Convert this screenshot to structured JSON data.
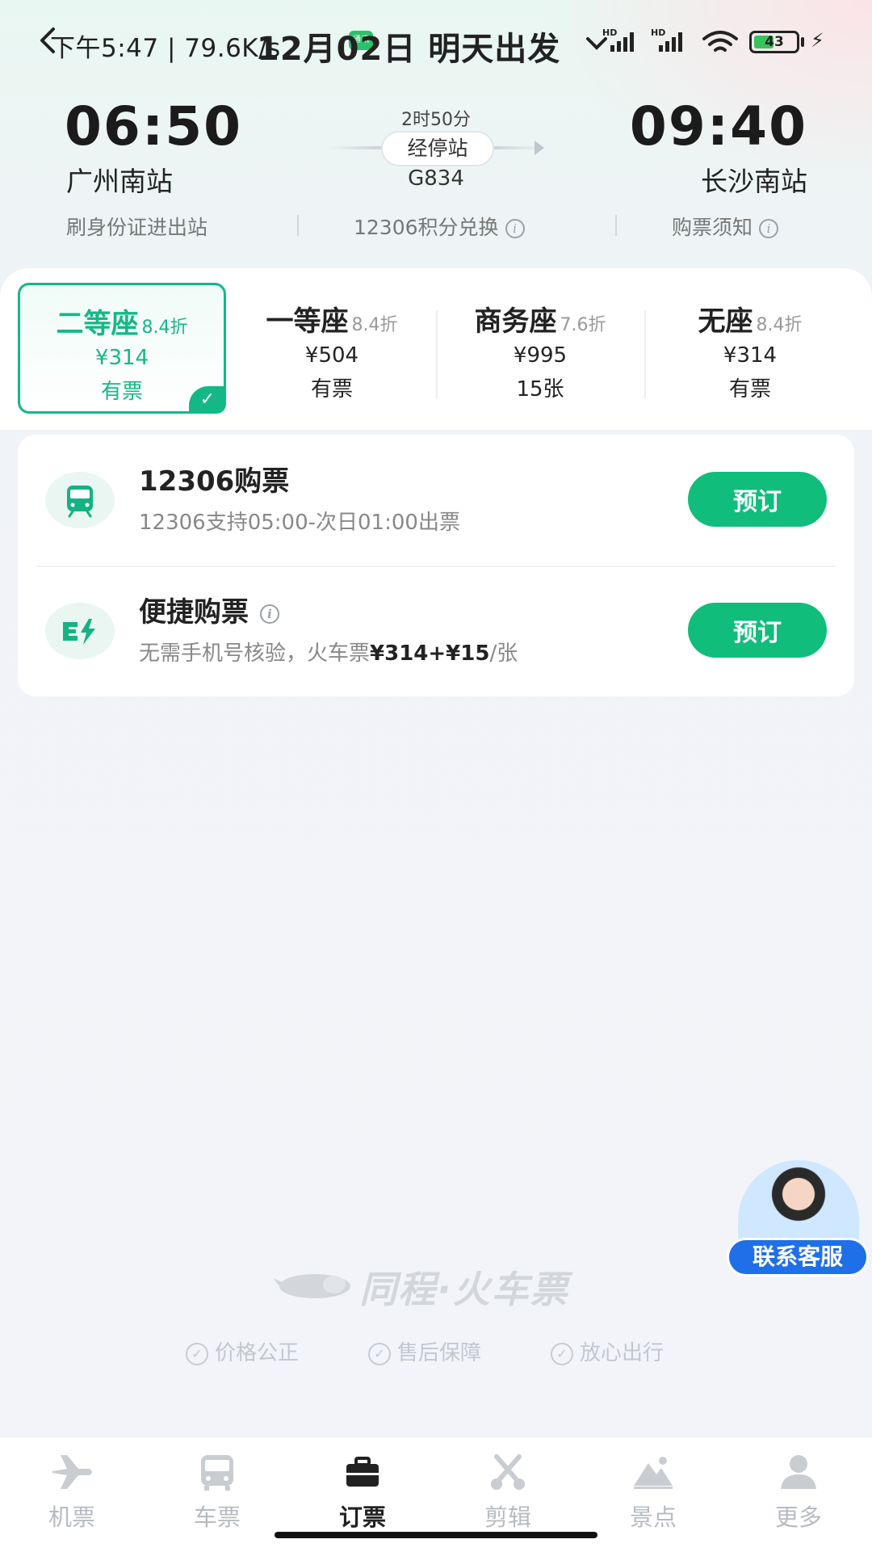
{
  "status_bar": {
    "time": "下午5:47 | 79.6K/s",
    "app_badge": "通讯",
    "battery": "43"
  },
  "header": {
    "date_title": "12月02日 明天出发"
  },
  "train": {
    "departure_time": "06:50",
    "departure_station": "广州南站",
    "arrival_time": "09:40",
    "arrival_station": "长沙南站",
    "duration": "2时50分",
    "stops_label": "经停站",
    "train_number": "G834"
  },
  "links": {
    "id_card": "刷身份证进出站",
    "points": "12306积分兑换",
    "notice": "购票须知"
  },
  "seats": [
    {
      "name": "二等座",
      "discount": "8.4折",
      "price": "¥314",
      "availability": "有票",
      "selected": true
    },
    {
      "name": "一等座",
      "discount": "8.4折",
      "price": "¥504",
      "availability": "有票",
      "selected": false
    },
    {
      "name": "商务座",
      "discount": "7.6折",
      "price": "¥995",
      "availability": "15张",
      "selected": false
    },
    {
      "name": "无座",
      "discount": "8.4折",
      "price": "¥314",
      "availability": "有票",
      "selected": false
    }
  ],
  "options": [
    {
      "title": "12306购票",
      "desc": "12306支持05:00-次日01:00出票",
      "button": "预订",
      "icon": "train-icon"
    },
    {
      "title": "便捷购票",
      "desc_prefix": "无需手机号核验，火车票",
      "desc_price": "¥314+¥15",
      "desc_suffix": "/张",
      "button": "预订",
      "icon": "fast-ticket-icon"
    }
  ],
  "brand": {
    "name": "同程·火车票",
    "promises": [
      "价格公正",
      "售后保障",
      "放心出行"
    ]
  },
  "service": {
    "label": "联系客服"
  },
  "tabbar": [
    {
      "label": "机票",
      "icon": "plane-icon",
      "active": false
    },
    {
      "label": "车票",
      "icon": "bus-icon",
      "active": false
    },
    {
      "label": "订票",
      "icon": "briefcase-icon",
      "active": true
    },
    {
      "label": "剪辑",
      "icon": "scissors-icon",
      "active": false
    },
    {
      "label": "景点",
      "icon": "mountain-icon",
      "active": false
    },
    {
      "label": "更多",
      "icon": "person-icon",
      "active": false
    }
  ],
  "colors": {
    "accent": "#14b887",
    "button": "#10bd7b",
    "service": "#1f6fe8"
  }
}
